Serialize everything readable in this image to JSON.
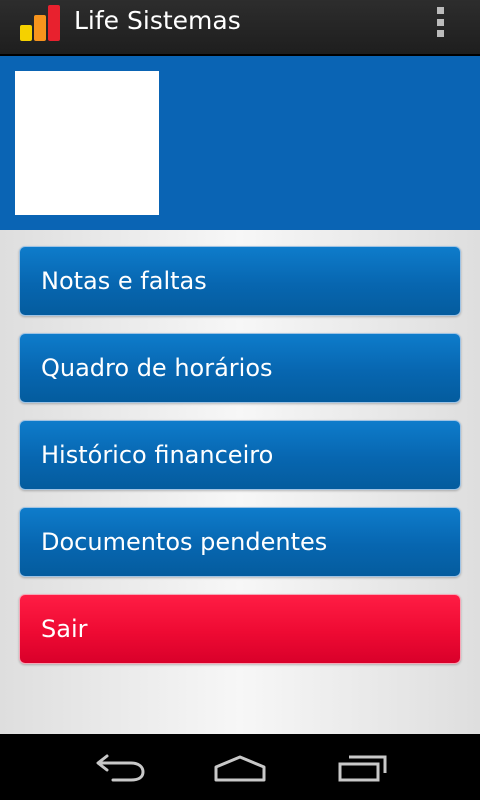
{
  "action_bar": {
    "title": "Life Sistemas",
    "app_icon": "bar-chart-logo-icon",
    "overflow_icon": "overflow-menu-icon"
  },
  "menu": {
    "items": [
      {
        "label": "Notas e faltas"
      },
      {
        "label": "Quadro de horários"
      },
      {
        "label": "Histórico financeiro"
      },
      {
        "label": "Documentos pendentes"
      },
      {
        "label": "Sair"
      }
    ]
  },
  "nav_bar": {
    "back_icon": "back-icon",
    "home_icon": "home-icon",
    "recents_icon": "recent-apps-icon"
  },
  "colors": {
    "banner": "#0a64b4",
    "primary_button": "#0766b0",
    "danger_button": "#ee0a33",
    "logo_yellow": "#f5d100",
    "logo_orange": "#f7941d",
    "logo_red": "#e8212e"
  }
}
